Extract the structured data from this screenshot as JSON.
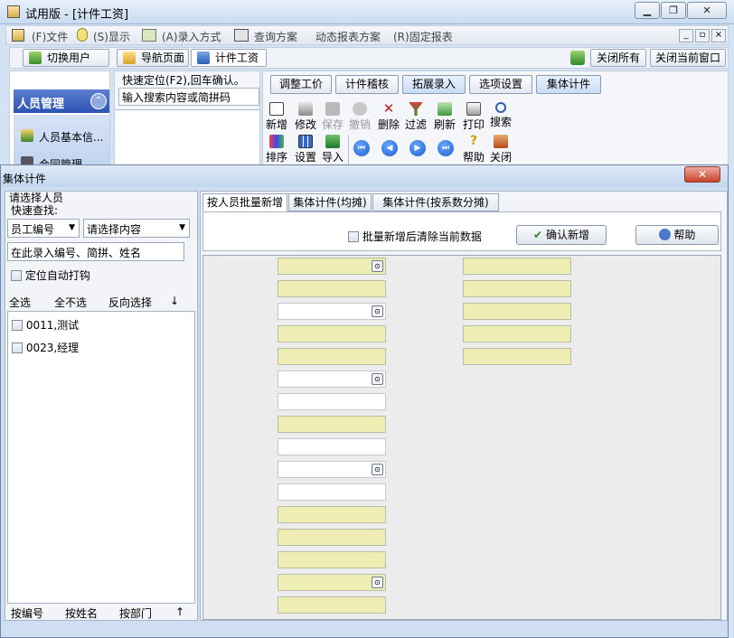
{
  "window": {
    "title": "试用版 - [计件工资]",
    "min": "0",
    "max": "1",
    "close": "x"
  },
  "menu": {
    "items": [
      "(F)文件",
      "(S)显示",
      "(A)录入方式",
      "查询方案",
      "动态报表方案",
      "(R)固定报表"
    ],
    "mdi": [
      "_",
      "▫",
      "×"
    ]
  },
  "tabbar": {
    "switch_user": "切换用户",
    "nav_page": "导航页面",
    "piece_wage": "计件工资",
    "close_all": "关闭所有",
    "close_current": "关闭当前窗口"
  },
  "nav": {
    "header": "人员管理",
    "item1": "人员基本信...",
    "item2": "合同管理"
  },
  "quicksearch": {
    "hint": "快速定位(F2),回车确认。",
    "placeholder": "输入搜索内容或简拼码"
  },
  "subtabs": [
    "调整工价",
    "计件稽核",
    "拓展录入",
    "选项设置",
    "集体计件"
  ],
  "tools_row1": [
    "新增",
    "修改",
    "保存",
    "撤销",
    "删除",
    "过滤",
    "刷新",
    "打印",
    "搜索"
  ],
  "tools_row2": [
    "排序",
    "设置",
    "导入",
    "帮助",
    "关闭"
  ],
  "dialog": {
    "title": "集体计件",
    "close": "x",
    "left": {
      "group_title": "请选择人员",
      "quick_find": "快速查找:",
      "field_combo": "员工编号",
      "content_combo": "请选择内容",
      "input_hint": "在此录入编号、简拼、姓名",
      "auto_check": "定位自动打钩",
      "select_all": "全选",
      "select_none": "全不选",
      "invert": "反向选择",
      "sort_down": "↓",
      "persons": [
        "0011,测试",
        "0023,经理"
      ],
      "sort_code": "按编号",
      "sort_name": "按姓名",
      "sort_dept": "按部门",
      "sort_up": "↑"
    },
    "right": {
      "tabs": [
        "按人员批量新增",
        "集体计件(均摊)",
        "集体计件(按系数分摊)"
      ],
      "clear_check": "批量新增后清除当前数据",
      "confirm": "确认新增",
      "help": "帮助"
    }
  },
  "colors": {
    "field_yellow": "#eeeeb4",
    "nav_blue": "#2c53b3"
  }
}
